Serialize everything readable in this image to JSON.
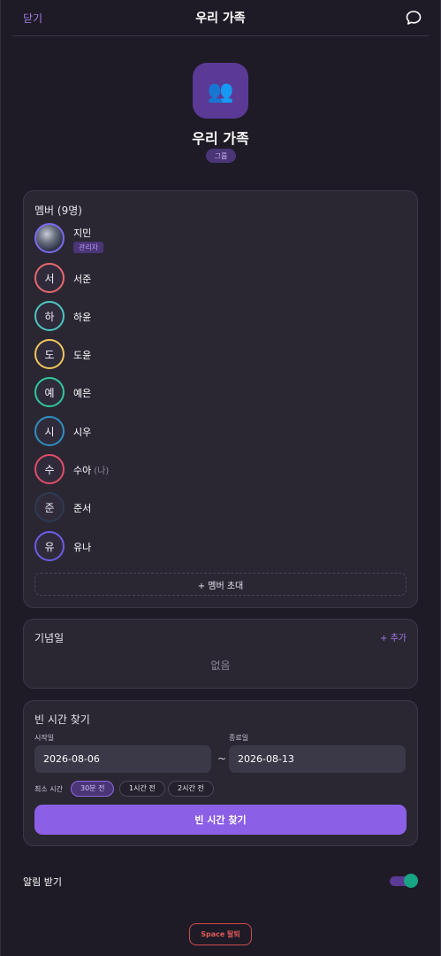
{
  "header": {
    "close_label": "닫기",
    "title": "우리 가족",
    "chat_icon": "chat-bubble-icon"
  },
  "space": {
    "icon": "👥",
    "name": "우리 가족",
    "type": "그룹"
  },
  "members": {
    "title": "멤버 (9명)",
    "items": [
      {
        "name": "지민",
        "initial": "",
        "role": "관리자",
        "ring_color": "#7c6af0",
        "photo": true
      },
      {
        "name": "서준",
        "initial": "서",
        "ring_color": "#e8686e"
      },
      {
        "name": "하윤",
        "initial": "하",
        "ring_color": "#4fc6c0"
      },
      {
        "name": "도윤",
        "initial": "도",
        "ring_color": "#f1c65d"
      },
      {
        "name": "예은",
        "initial": "예",
        "ring_color": "#2fc99a"
      },
      {
        "name": "시우",
        "initial": "시",
        "ring_color": "#2f8fc0"
      },
      {
        "name": "수아",
        "initial": "수",
        "ring_color": "#e34c6b",
        "me_label": "(나)"
      },
      {
        "name": "준서",
        "initial": "준",
        "ring_color": "#2e3a52"
      },
      {
        "name": "유나",
        "initial": "유",
        "ring_color": "#6c5ce7"
      }
    ],
    "invite_label": "+ 멤버 초대"
  },
  "anniversaries": {
    "title": "기념일",
    "add_label": "+ 추가",
    "empty_label": "없음"
  },
  "free_time": {
    "title": "빈 시간 찾기",
    "start_label": "시작일",
    "start_value": "2026-08-06",
    "end_label": "종료일",
    "end_value": "2026-08-13",
    "tilde": "~",
    "min_time_label": "최소 시간",
    "chips": [
      {
        "label": "30분 전",
        "active": true
      },
      {
        "label": "1시간 전",
        "active": false
      },
      {
        "label": "2시간 전",
        "active": false
      }
    ],
    "search_label": "빈 시간 찾기"
  },
  "notifications": {
    "label": "알림 받기",
    "enabled": true
  },
  "leave_label": "Space 탈퇴",
  "colors": {
    "accent": "#8b5fe6",
    "danger": "#e05a5a",
    "toggle_on": "#18a583"
  }
}
